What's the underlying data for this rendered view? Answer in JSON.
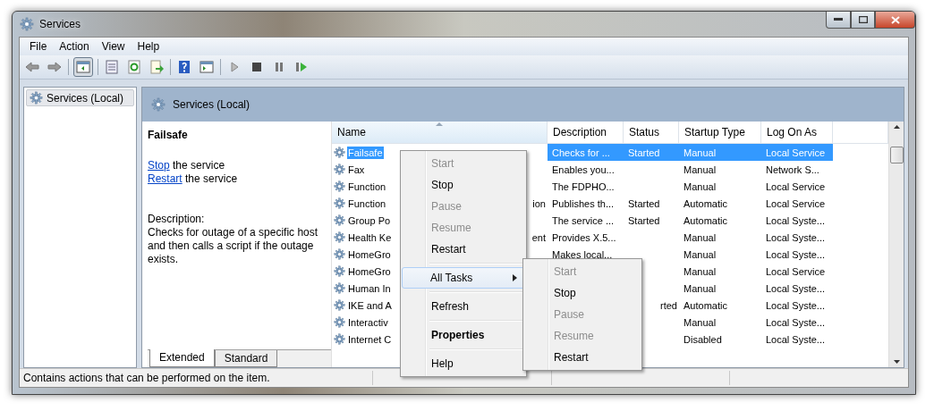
{
  "window": {
    "title": "Services"
  },
  "menu_bar": [
    "File",
    "Action",
    "View",
    "Help"
  ],
  "tree": {
    "items": [
      {
        "label": "Services (Local)",
        "selected": true
      }
    ]
  },
  "pane_header": {
    "title": "Services (Local)"
  },
  "details": {
    "service_name": "Failsafe",
    "actions": [
      {
        "link": "Stop",
        "text": "the service"
      },
      {
        "link": "Restart",
        "text": "the service"
      }
    ],
    "description_label": "Description:",
    "description": "Checks for outage of a specific host and then calls a script if the outage exists."
  },
  "table": {
    "columns": [
      {
        "label": "Name",
        "sorted": true
      },
      {
        "label": "Description",
        "sorted": false
      },
      {
        "label": "Status",
        "sorted": false
      },
      {
        "label": "Startup Type",
        "sorted": false
      },
      {
        "label": "Log On As",
        "sorted": false
      }
    ],
    "rows": [
      {
        "name": "Failsafe",
        "description": "Checks for ...",
        "status": "Started",
        "startup": "Manual",
        "logon": "Local Service",
        "selected": true
      },
      {
        "name": "Fax",
        "description": "Enables you...",
        "status": "",
        "startup": "Manual",
        "logon": "Network S...",
        "selected": false
      },
      {
        "name": "Function",
        "description": "The FDPHO...",
        "status": "",
        "startup": "Manual",
        "logon": "Local Service",
        "selected": false
      },
      {
        "name": "Function",
        "name_tail": "ion",
        "description": "Publishes th...",
        "status": "Started",
        "startup": "Automatic",
        "logon": "Local Service",
        "selected": false
      },
      {
        "name": "Group Po",
        "description": "The service ...",
        "status": "Started",
        "startup": "Automatic",
        "logon": "Local Syste...",
        "selected": false
      },
      {
        "name": "Health Ke",
        "name_tail": "ent",
        "description": "Provides X.5...",
        "status": "",
        "startup": "Manual",
        "logon": "Local Syste...",
        "selected": false
      },
      {
        "name": "HomeGro",
        "description": "Makes local...",
        "status": "",
        "startup": "Manual",
        "logon": "Local Syste...",
        "selected": false
      },
      {
        "name": "HomeGro",
        "description": "",
        "status": "",
        "startup": "Manual",
        "logon": "Local Service",
        "selected": false
      },
      {
        "name": "Human In",
        "description": "",
        "status": "",
        "startup": "Manual",
        "logon": "Local Syste...",
        "selected": false
      },
      {
        "name": "IKE and A",
        "description": "",
        "status": "rted",
        "status_clipped": true,
        "startup": "Automatic",
        "logon": "Local Syste...",
        "selected": false
      },
      {
        "name": "Interactiv",
        "description": "",
        "status": "",
        "startup": "Manual",
        "logon": "Local Syste...",
        "selected": false
      },
      {
        "name": "Internet C",
        "description": "",
        "status": "",
        "startup": "Disabled",
        "logon": "Local Syste...",
        "selected": false
      }
    ]
  },
  "view_tabs": [
    {
      "label": "Extended",
      "selected": true
    },
    {
      "label": "Standard",
      "selected": false
    }
  ],
  "context_menu": {
    "items": [
      {
        "kind": "item",
        "label": "Start",
        "disabled": true,
        "highlighted": false
      },
      {
        "kind": "item",
        "label": "Stop",
        "disabled": false,
        "highlighted": false
      },
      {
        "kind": "item",
        "label": "Pause",
        "disabled": true,
        "highlighted": false
      },
      {
        "kind": "item",
        "label": "Resume",
        "disabled": true,
        "highlighted": false
      },
      {
        "kind": "item",
        "label": "Restart",
        "disabled": false,
        "highlighted": false
      },
      {
        "kind": "separator"
      },
      {
        "kind": "submenu",
        "label": "All Tasks",
        "disabled": false,
        "highlighted": true
      },
      {
        "kind": "separator"
      },
      {
        "kind": "item",
        "label": "Refresh",
        "disabled": false,
        "highlighted": false
      },
      {
        "kind": "separator"
      },
      {
        "kind": "default",
        "label": "Properties",
        "disabled": false,
        "highlighted": false
      },
      {
        "kind": "separator"
      },
      {
        "kind": "item",
        "label": "Help",
        "disabled": false,
        "highlighted": false
      }
    ],
    "submenu": [
      {
        "kind": "item",
        "label": "Start",
        "disabled": true,
        "highlighted": false
      },
      {
        "kind": "item",
        "label": "Stop",
        "disabled": false,
        "highlighted": false
      },
      {
        "kind": "item",
        "label": "Pause",
        "disabled": true,
        "highlighted": false
      },
      {
        "kind": "item",
        "label": "Resume",
        "disabled": true,
        "highlighted": false
      },
      {
        "kind": "item",
        "label": "Restart",
        "disabled": false,
        "highlighted": false
      }
    ]
  },
  "status_bar": "Contains actions that can be performed on the item."
}
